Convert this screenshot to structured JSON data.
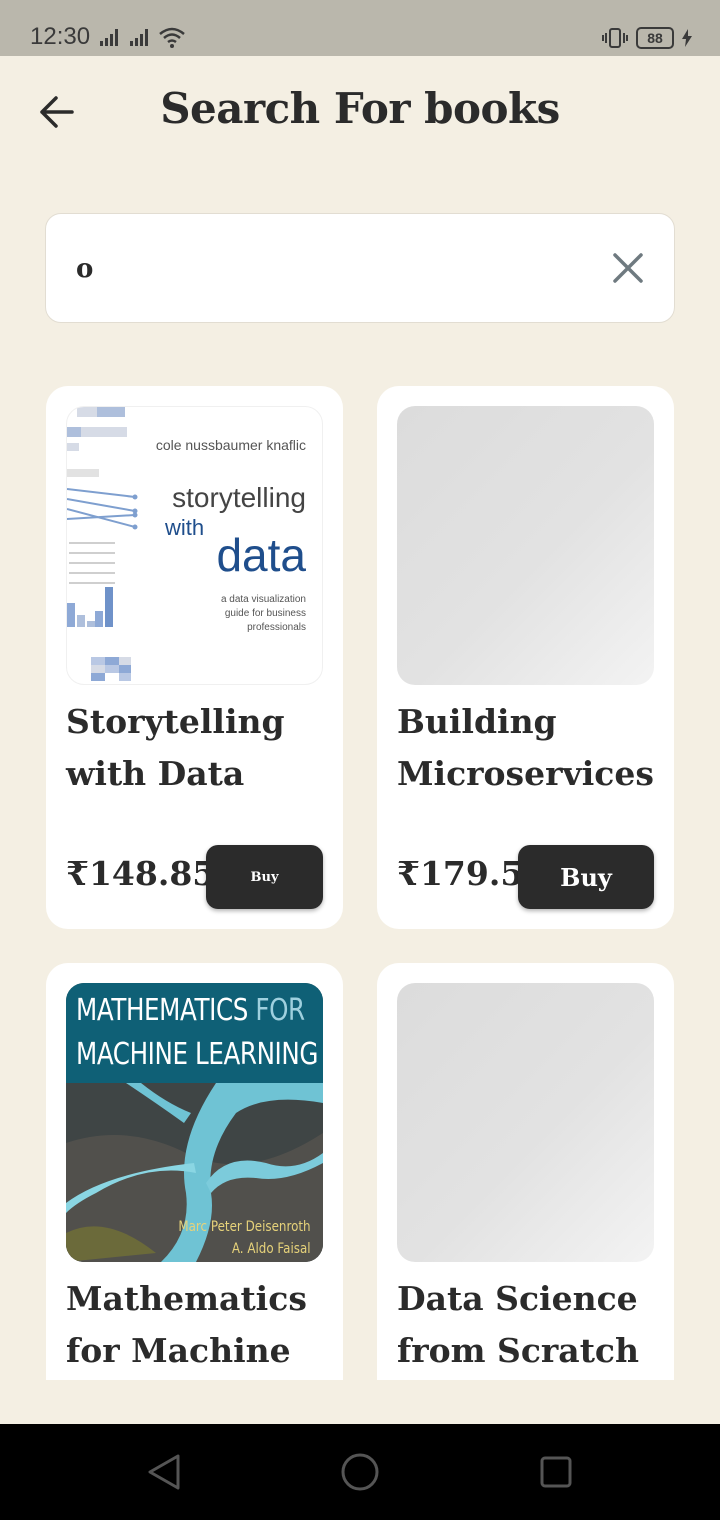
{
  "status_bar": {
    "time": "12:30",
    "battery": "88"
  },
  "header": {
    "title": "Search For books"
  },
  "search": {
    "value": "o"
  },
  "books": [
    {
      "title": "Storytelling with Data",
      "price": "₹148.85",
      "buy_label": "Buy",
      "cover": {
        "author": "cole nussbaumer knaflic",
        "title_line1": "storytelling",
        "title_line2": "with",
        "title_line3": "data",
        "subtitle": "a data visualization guide for business professionals"
      }
    },
    {
      "title": "Building Microservices",
      "price": "₹179.5",
      "buy_label": "Buy"
    },
    {
      "title": "Mathematics for Machine L…",
      "cover": {
        "title_line1": "MATHEMATICS",
        "title_for": "FOR",
        "title_line2": "MACHINE LEARNING",
        "author1": "Marc Peter Deisenroth",
        "author2": "A. Aldo Faisal"
      }
    },
    {
      "title": "Data Science from Scratch"
    }
  ],
  "colors": {
    "background": "#f4efe3",
    "card": "#ffffff",
    "button": "#2b2b2b",
    "status_bar": "#bab7ac"
  },
  "icons": [
    "back-arrow-icon",
    "close-icon",
    "nav-back-icon",
    "nav-home-icon",
    "nav-recents-icon"
  ]
}
